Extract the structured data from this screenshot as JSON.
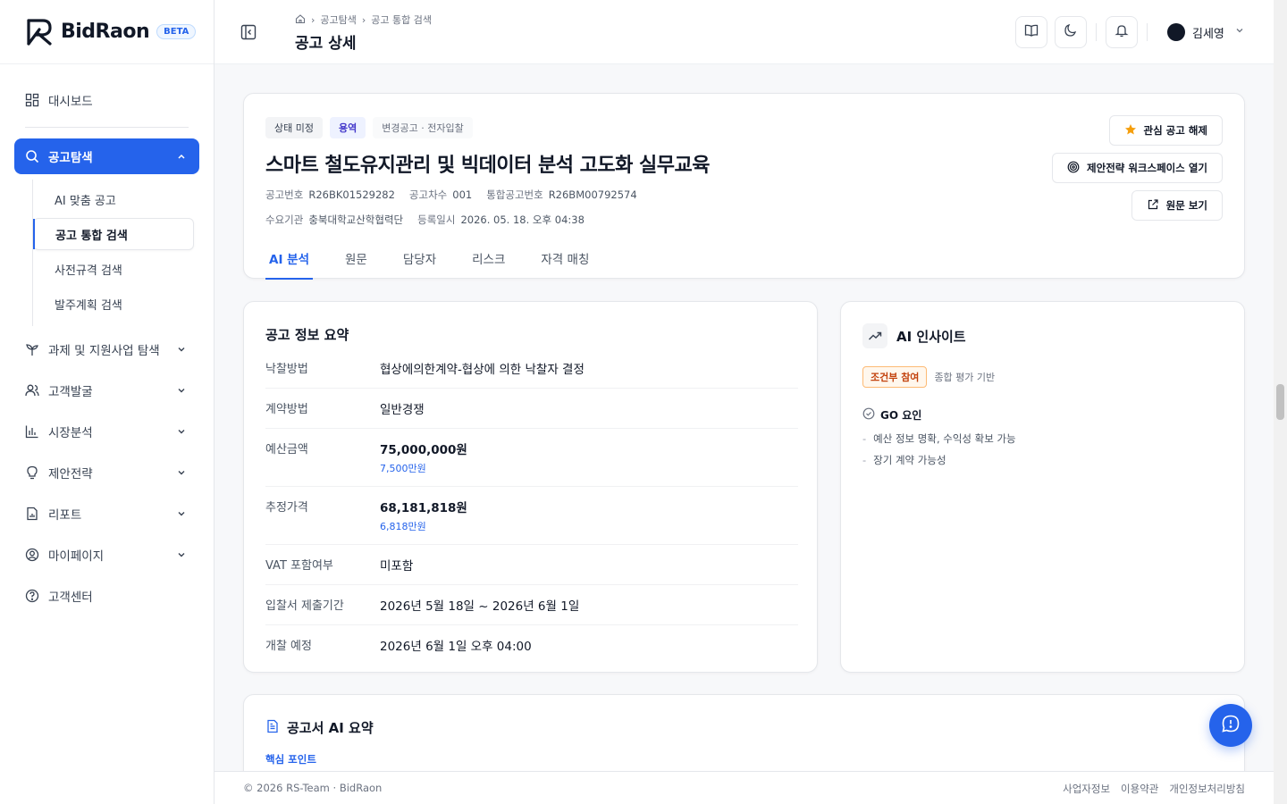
{
  "brand": {
    "name": "BidRaon",
    "beta": "BETA"
  },
  "sidebar": {
    "dashboard": "대시보드",
    "explore": "공고탐색",
    "explore_sub": [
      "AI 맞춤 공고",
      "공고 통합 검색",
      "사전규격 검색",
      "발주계획 검색"
    ],
    "items": [
      "과제 및 지원사업 탐색",
      "고객발굴",
      "시장분석",
      "제안전략",
      "리포트",
      "마이페이지",
      "고객센터"
    ]
  },
  "header": {
    "crumbs": [
      "공고탐색",
      "공고 통합 검색"
    ],
    "title": "공고 상세",
    "user": "김세영"
  },
  "notice": {
    "badges": [
      "상태 미정",
      "용역",
      "변경공고 · 전자입찰"
    ],
    "title": "스마트 철도유지관리 및 빅데이터 분석 고도화 실무교육",
    "meta1": [
      {
        "k": "공고번호",
        "v": "R26BK01529282"
      },
      {
        "k": "공고차수",
        "v": "001"
      },
      {
        "k": "통합공고번호",
        "v": "R26BM00792574"
      }
    ],
    "meta2": [
      {
        "k": "수요기관",
        "v": "충북대학교산학협력단"
      },
      {
        "k": "등록일시",
        "v": "2026. 05. 18. 오후 04:38"
      }
    ],
    "tabs": [
      "AI 분석",
      "원문",
      "담당자",
      "리스크",
      "자격 매칭"
    ],
    "actions": [
      "관심 공고 해제",
      "제안전략 워크스페이스 열기",
      "원문 보기"
    ]
  },
  "summary": {
    "title": "공고 정보 요약",
    "rows": [
      {
        "k": "낙찰방법",
        "v": "협상에의한계약-협상에 의한 낙찰자 결정",
        "sub": ""
      },
      {
        "k": "계약방법",
        "v": "일반경쟁",
        "sub": ""
      },
      {
        "k": "예산금액",
        "v": "75,000,000원",
        "sub": "7,500만원"
      },
      {
        "k": "추정가격",
        "v": "68,181,818원",
        "sub": "6,818만원"
      },
      {
        "k": "VAT 포함여부",
        "v": "미포함",
        "sub": ""
      },
      {
        "k": "입찰서 제출기간",
        "v": "2026년 5월 18일 ~ 2026년 6월 1일",
        "sub": ""
      },
      {
        "k": "개찰 예정",
        "v": "2026년 6월 1일 오후 04:00",
        "sub": ""
      }
    ]
  },
  "insight": {
    "title": "AI 인사이트",
    "tag": "조건부 참여",
    "tag_note": "종합 평가 기반",
    "go_title": "GO 요인",
    "go_items": [
      "예산 정보 명확, 수익성 확보 가능",
      "장기 계약 가능성"
    ]
  },
  "ai_summary": {
    "title": "공고서 AI 요약",
    "sub": "핵심 포인트"
  },
  "footer": {
    "copy": "© 2026 RS-Team · BidRaon",
    "links": [
      "사업자정보",
      "이용약관",
      "개인정보처리방침"
    ]
  },
  "colors": {
    "accent": "#2563eb",
    "warning": "#c2410c"
  }
}
